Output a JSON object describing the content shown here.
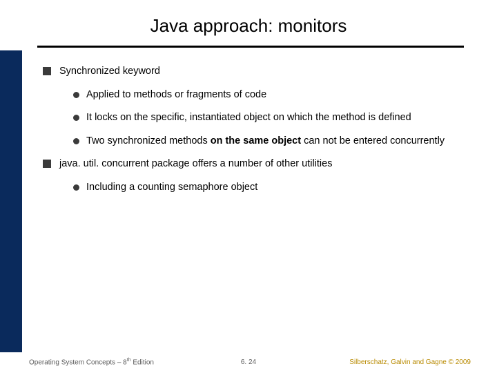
{
  "title": "Java approach: monitors",
  "bullets": {
    "b1": "Synchronized keyword",
    "b1_1": "Applied to methods or fragments of code",
    "b1_2": "It locks on the specific, instantiated object on which the method is defined",
    "b1_3_pre": "Two synchronized methods ",
    "b1_3_bold": "on the same object",
    "b1_3_post": " can not be entered concurrently",
    "b2": "java. util. concurrent  package offers a number of other utilities",
    "b2_1": "Including a counting semaphore object"
  },
  "footer": {
    "left_pre": "Operating System Concepts – 8",
    "left_sup": "th",
    "left_post": " Edition",
    "center": "6. 24",
    "right": "Silberschatz, Galvin and Gagne © 2009"
  }
}
